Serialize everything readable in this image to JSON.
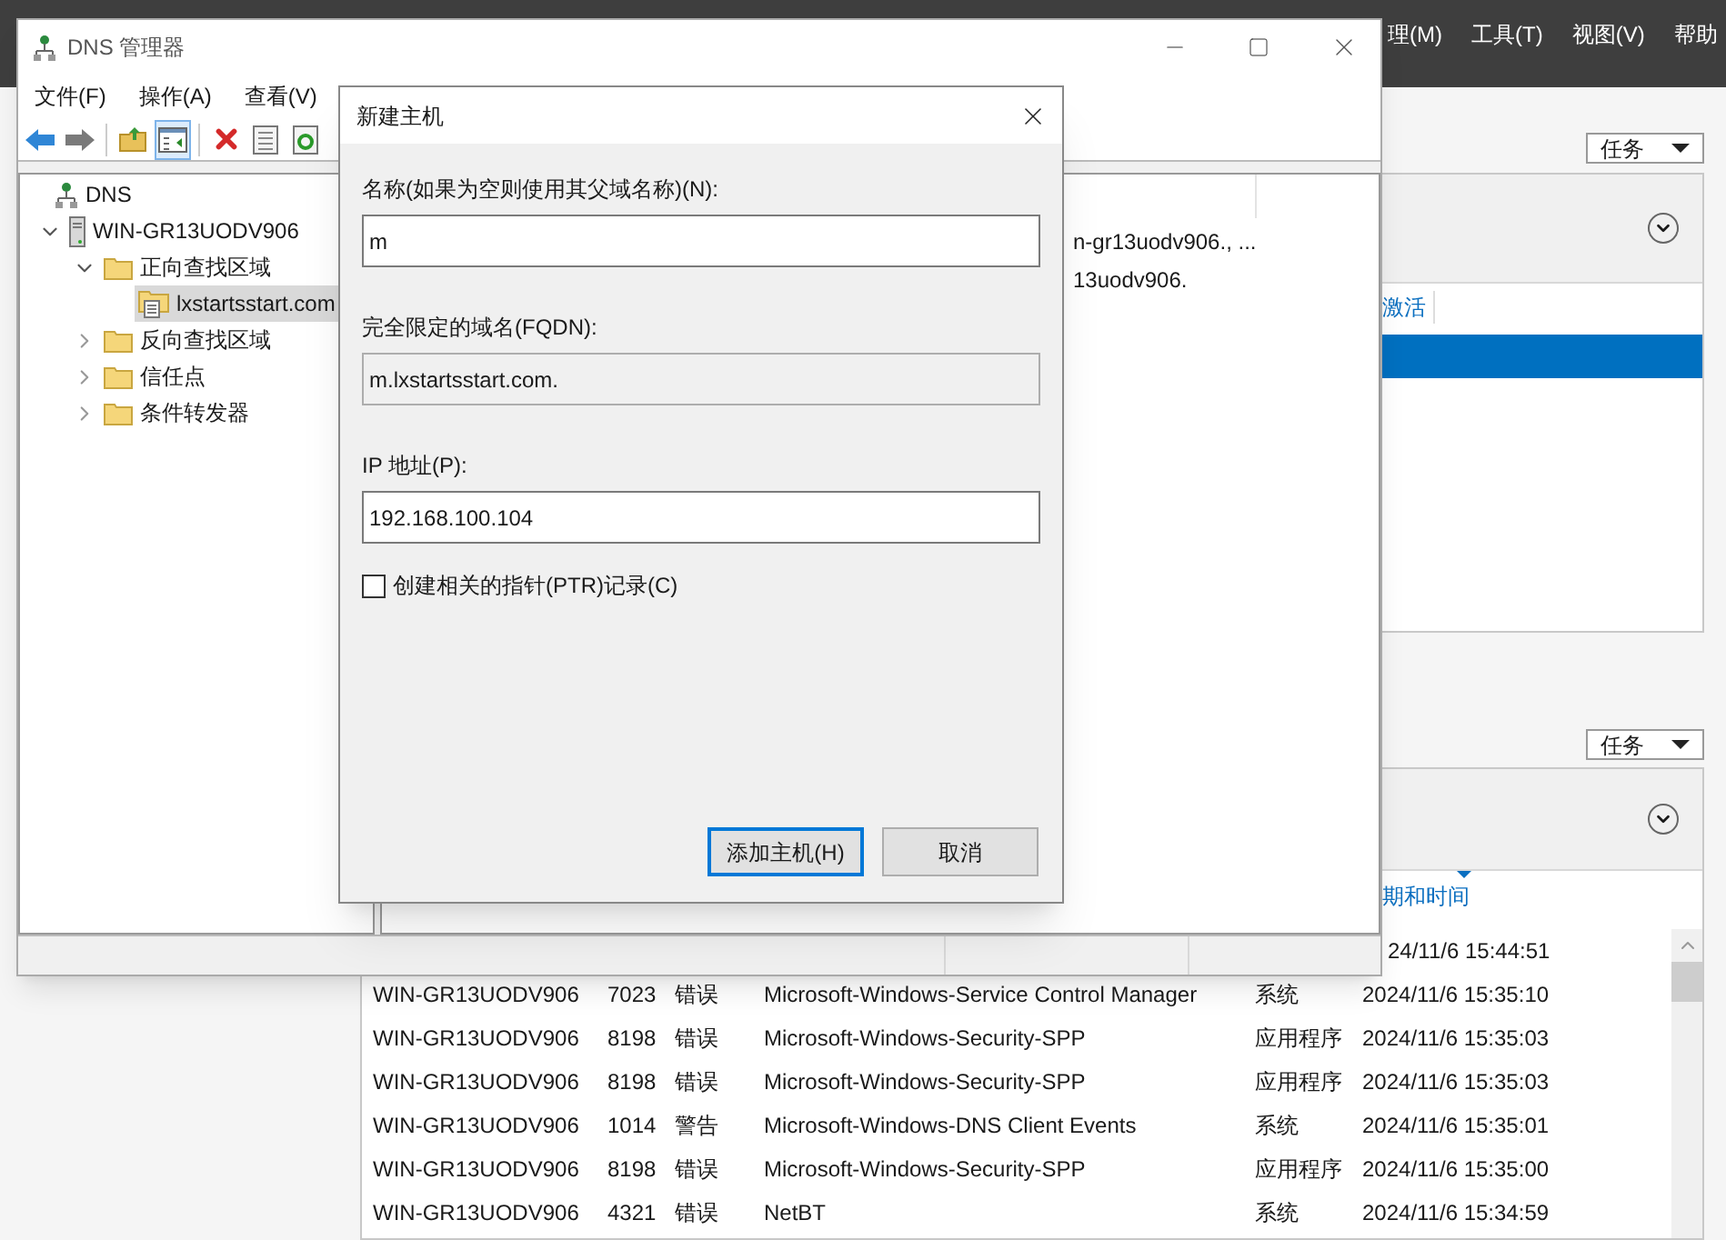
{
  "server_manager": {
    "menu": [
      "理(M)",
      "工具(T)",
      "视图(V)",
      "帮助"
    ],
    "panels": [
      {
        "task_button": "任务",
        "rows": [
          {
            "label": "激活",
            "selected": false
          },
          {
            "label": "",
            "selected": true
          }
        ]
      },
      {
        "task_button": "任务",
        "sort_column": "期和时间",
        "events": [
          {
            "time": "24/11/6 15:44:51"
          },
          {
            "server": "WIN-GR13UODV906",
            "id": "7023",
            "level": "错误",
            "source": "Microsoft-Windows-Service Control Manager",
            "log": "系统",
            "time": "2024/11/6 15:35:10"
          },
          {
            "server": "WIN-GR13UODV906",
            "id": "8198",
            "level": "错误",
            "source": "Microsoft-Windows-Security-SPP",
            "log": "应用程序",
            "time": "2024/11/6 15:35:03"
          },
          {
            "server": "WIN-GR13UODV906",
            "id": "8198",
            "level": "错误",
            "source": "Microsoft-Windows-Security-SPP",
            "log": "应用程序",
            "time": "2024/11/6 15:35:03"
          },
          {
            "server": "WIN-GR13UODV906",
            "id": "1014",
            "level": "警告",
            "source": "Microsoft-Windows-DNS Client Events",
            "log": "系统",
            "time": "2024/11/6 15:35:01"
          },
          {
            "server": "WIN-GR13UODV906",
            "id": "8198",
            "level": "错误",
            "source": "Microsoft-Windows-Security-SPP",
            "log": "应用程序",
            "time": "2024/11/6 15:35:00"
          },
          {
            "server": "WIN-GR13UODV906",
            "id": "4321",
            "level": "错误",
            "source": "NetBT",
            "log": "系统",
            "time": "2024/11/6 15:34:59"
          }
        ]
      }
    ]
  },
  "dns_window": {
    "title": "DNS 管理器",
    "menu": [
      "文件(F)",
      "操作(A)",
      "查看(V)"
    ],
    "toolbar": [
      {
        "kind": "back",
        "on": false
      },
      {
        "kind": "forward",
        "on": false
      },
      {
        "kind": "up",
        "on": false
      },
      {
        "kind": "tree",
        "on": true
      },
      {
        "kind": "delete",
        "on": false
      },
      {
        "kind": "properties",
        "on": false
      },
      {
        "kind": "refresh",
        "on": false
      }
    ],
    "tree": [
      {
        "label": "DNS",
        "kind": "root",
        "selected": false,
        "children": [
          {
            "label": "WIN-GR13UODV906",
            "kind": "server",
            "selected": false,
            "expanded": true,
            "children": [
              {
                "label": "正向查找区域",
                "kind": "folder",
                "selected": false,
                "expanded": true,
                "children": [
                  {
                    "label": "lxstartsstart.com",
                    "kind": "zone",
                    "selected": true
                  }
                ]
              },
              {
                "label": "反向查找区域",
                "kind": "folder",
                "selected": false,
                "expanded": false
              },
              {
                "label": "信任点",
                "kind": "folder",
                "selected": false,
                "expanded": false
              },
              {
                "label": "条件转发器",
                "kind": "folder",
                "selected": false,
                "expanded": false
              }
            ]
          }
        ]
      }
    ],
    "records": [
      "n-gr13uodv906., ...",
      "13uodv906."
    ]
  },
  "dialog": {
    "title": "新建主机",
    "fields": [
      {
        "label": "名称(如果为空则使用其父域名称)(N):",
        "value": "m",
        "disabled": false
      },
      {
        "label": "完全限定的域名(FQDN):",
        "value": "m.lxstartsstart.com.",
        "disabled": true
      },
      {
        "label": "IP 地址(P):",
        "value": "192.168.100.104",
        "disabled": false
      }
    ],
    "checkbox": {
      "label": "创建相关的指针(PTR)记录(C)",
      "checked": false
    },
    "buttons": [
      {
        "label": "添加主机(H)",
        "default": true
      },
      {
        "label": "取消",
        "default": false
      }
    ]
  }
}
